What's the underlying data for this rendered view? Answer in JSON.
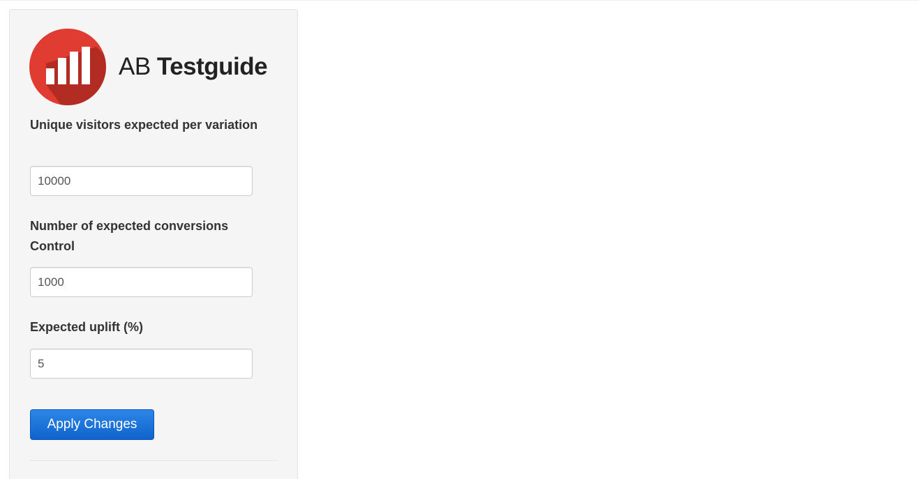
{
  "brand": {
    "name_light": "AB ",
    "name_bold": "Testguide",
    "logo_icon": "bar-chart-icon",
    "logo_color": "#e03c31",
    "logo_shadow_color": "#8e1f1a"
  },
  "form": {
    "visitors": {
      "label": "Unique visitors expected per variation",
      "value": "10000"
    },
    "conversions": {
      "label": "Number of expected conversions Control",
      "value": "1000"
    },
    "uplift": {
      "label": "Expected uplift (%)",
      "value": "5"
    },
    "apply_label": "Apply Changes"
  },
  "colors": {
    "accent": "#1a6fd8",
    "panel_bg": "#f5f5f5"
  }
}
